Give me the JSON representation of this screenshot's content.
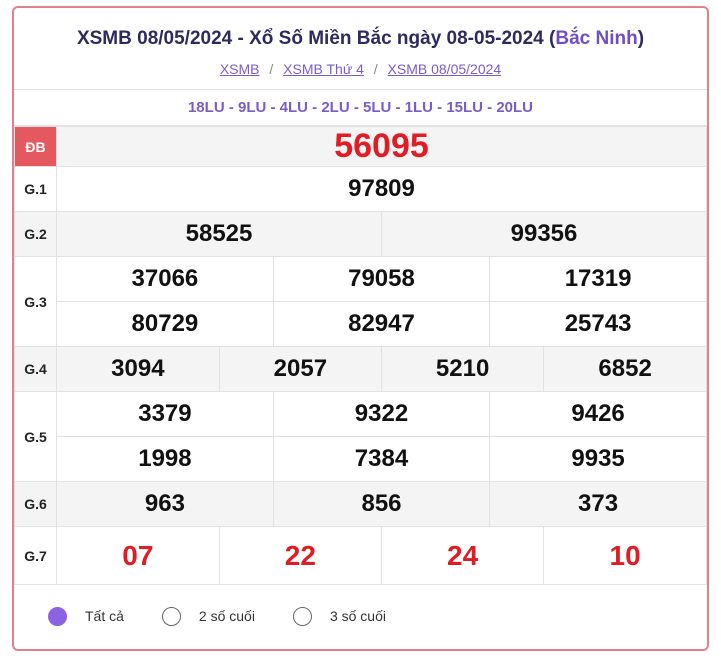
{
  "header": {
    "title": "XSMB 08/05/2024 - Xổ Số Miền Bắc ngày 08-05-2024",
    "province": "Bắc Ninh",
    "breadcrumbs": [
      "XSMB",
      "XSMB Thứ 4",
      "XSMB 08/05/2024"
    ]
  },
  "codes": "18LU - 9LU - 4LU - 2LU - 5LU - 1LU - 15LU - 20LU",
  "prizes": {
    "db": {
      "label": "ĐB",
      "value": "56095"
    },
    "g1": {
      "label": "G.1",
      "values": [
        "97809"
      ]
    },
    "g2": {
      "label": "G.2",
      "values": [
        "58525",
        "99356"
      ]
    },
    "g3": {
      "label": "G.3",
      "values": [
        "37066",
        "79058",
        "17319",
        "80729",
        "82947",
        "25743"
      ]
    },
    "g4": {
      "label": "G.4",
      "values": [
        "3094",
        "2057",
        "5210",
        "6852"
      ]
    },
    "g5": {
      "label": "G.5",
      "values": [
        "3379",
        "9322",
        "9426",
        "1998",
        "7384",
        "9935"
      ]
    },
    "g6": {
      "label": "G.6",
      "values": [
        "963",
        "856",
        "373"
      ]
    },
    "g7": {
      "label": "G.7",
      "values": [
        "07",
        "22",
        "24",
        "10"
      ]
    }
  },
  "options": [
    {
      "label": "Tất cả",
      "selected": true
    },
    {
      "label": "2 số cuối",
      "selected": false
    },
    {
      "label": "3 số cuối",
      "selected": false
    }
  ],
  "colors": {
    "accent": "#7a5cc7",
    "prize_red": "#e01c25",
    "db_bg": "#e4595f",
    "border": "#e0828a"
  }
}
